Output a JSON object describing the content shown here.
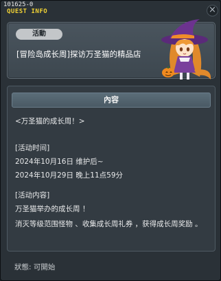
{
  "window": {
    "quest_id": "101625-0",
    "title": "QUEST INFO",
    "close_label": "×"
  },
  "summary": {
    "badge": "活動",
    "quest_title": "[冒险岛成长周]探访万圣猫的精品店"
  },
  "content": {
    "header": "內容",
    "heading": "<万圣猫的成长周！>",
    "time_label": "[活动时间]",
    "time_start": "2024年10月16日  维护后~",
    "time_end": "2024年10月29日  晚上11点59分",
    "detail_label": "[活动内容]",
    "detail_line1": "万圣猫举办的成长周 ！",
    "detail_line2": "消灭等级范围怪物 、收集成长周礼券 ，获得成长周奖励 。"
  },
  "status": {
    "text": "狀態:  可開始"
  },
  "colors": {
    "title_yellow": "#f2d335",
    "panel_bg": "#2a3137",
    "badge_bg": "#c3c6c9"
  }
}
